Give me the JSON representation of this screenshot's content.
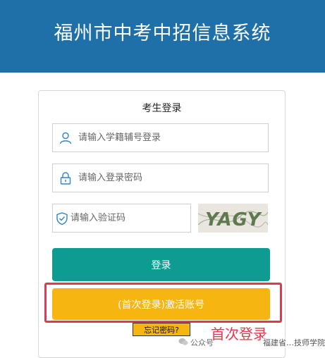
{
  "header": {
    "title": "福州市中考中招信息系统"
  },
  "login_panel": {
    "title": "考生登录",
    "student_id": {
      "placeholder": "请输入学籍辅号登录",
      "value": ""
    },
    "password": {
      "placeholder": "请输入登录密码",
      "value": ""
    },
    "captcha": {
      "placeholder": "请输入验证码",
      "value": "",
      "image_text": "YAGY"
    },
    "login_button": "登录",
    "activate_button": "(首次登录)激活账号",
    "forgot_link": "忘记密码?"
  },
  "annotation": {
    "text": "首次登录",
    "color": "#e2384f"
  },
  "watermark": {
    "prefix": "公众号",
    "name": "福建省…技师学院"
  },
  "colors": {
    "header": "#1f6fa8",
    "login": "#0e9c92",
    "activate": "#f7b512",
    "highlight": "#e2384f"
  }
}
